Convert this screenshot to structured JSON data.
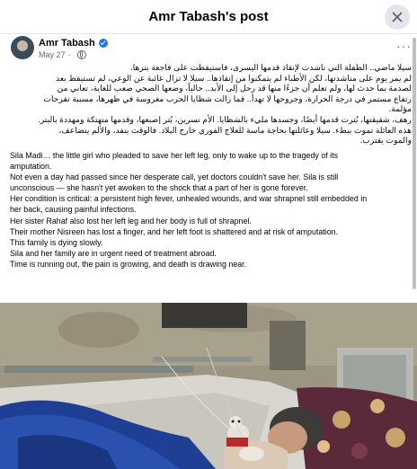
{
  "dialog": {
    "title": "Amr Tabash's post",
    "close_icon": "close-icon"
  },
  "post": {
    "author": "Amr Tabash",
    "date": "May 27",
    "separator": "·",
    "more_label": "···",
    "arabic_lines": [
      "سيلا ماضي.. الطفلة التي ناشدت لإنقاذ قدمها اليسرى، فاستيقظت على فاجعة بترها.",
      "لم يمر يوم على مناشدتها، لكن الأطباء لم يتمكنوا من إنقاذها.. سيلا لا تزال غائبة عن الوعي، لم تستيقظ بعد",
      "لصدمة بما حدث لها، ولم تعلم أن جزءًا منها قد رحل إلى الأبد.. حالياً، وضعها الصحي صعب للغاية، تعاني من",
      "رتفاع مستمر في درجة الحرارة، وجروحها لا تهدأ.. فما زالت شظايا الحرب مغروسة في ظهرها، مسببة تقرحات",
      "مؤلمة.",
      "رهف، شقيقتها، بُترت قدمها أيضًا، وجسدها مليء بالشظايا. الأم نسرين، بُتر إصبعها، وقدمها متهتكة ومهددة بالبتر.",
      "هذه العائلة تموت ببطء. سيلا وعائلتها بحاجة ماسة للعلاج الفوري خارج البلاد. فالوقت ينفد، والألم يتضاعف،",
      "والموت يقترب."
    ],
    "english_lines": [
      "Sila Madi… the little girl who pleaded to save her left leg, only to wake up to the tragedy of its",
      "amputation.",
      "Not even a day had passed since her desperate call, yet doctors couldn't save her. Sila is still",
      "unconscious — she hasn't yet awoken to the shock that a part of her is gone forever.",
      "Her condition is critical: a persistent high fever, unhealed wounds, and war shrapnel still embedded in",
      "her back, causing painful infections.",
      "Her sister Rahaf also lost her left leg and her body is full of shrapnel.",
      "Their mother Nisreen has lost a finger, and her left foot is shattered and at risk of amputation.",
      "This family is dying slowly.",
      "Sila and her family are in urgent need of treatment abroad.",
      "Time is running out, the pain is growing, and death is drawing near."
    ],
    "photo": "photo of a child lying in a hospital bed with a blue blanket and a stuffed toy"
  },
  "colors": {
    "verified": "#1877f2",
    "secondary_text": "#65676b",
    "divider": "#e4e6eb"
  }
}
